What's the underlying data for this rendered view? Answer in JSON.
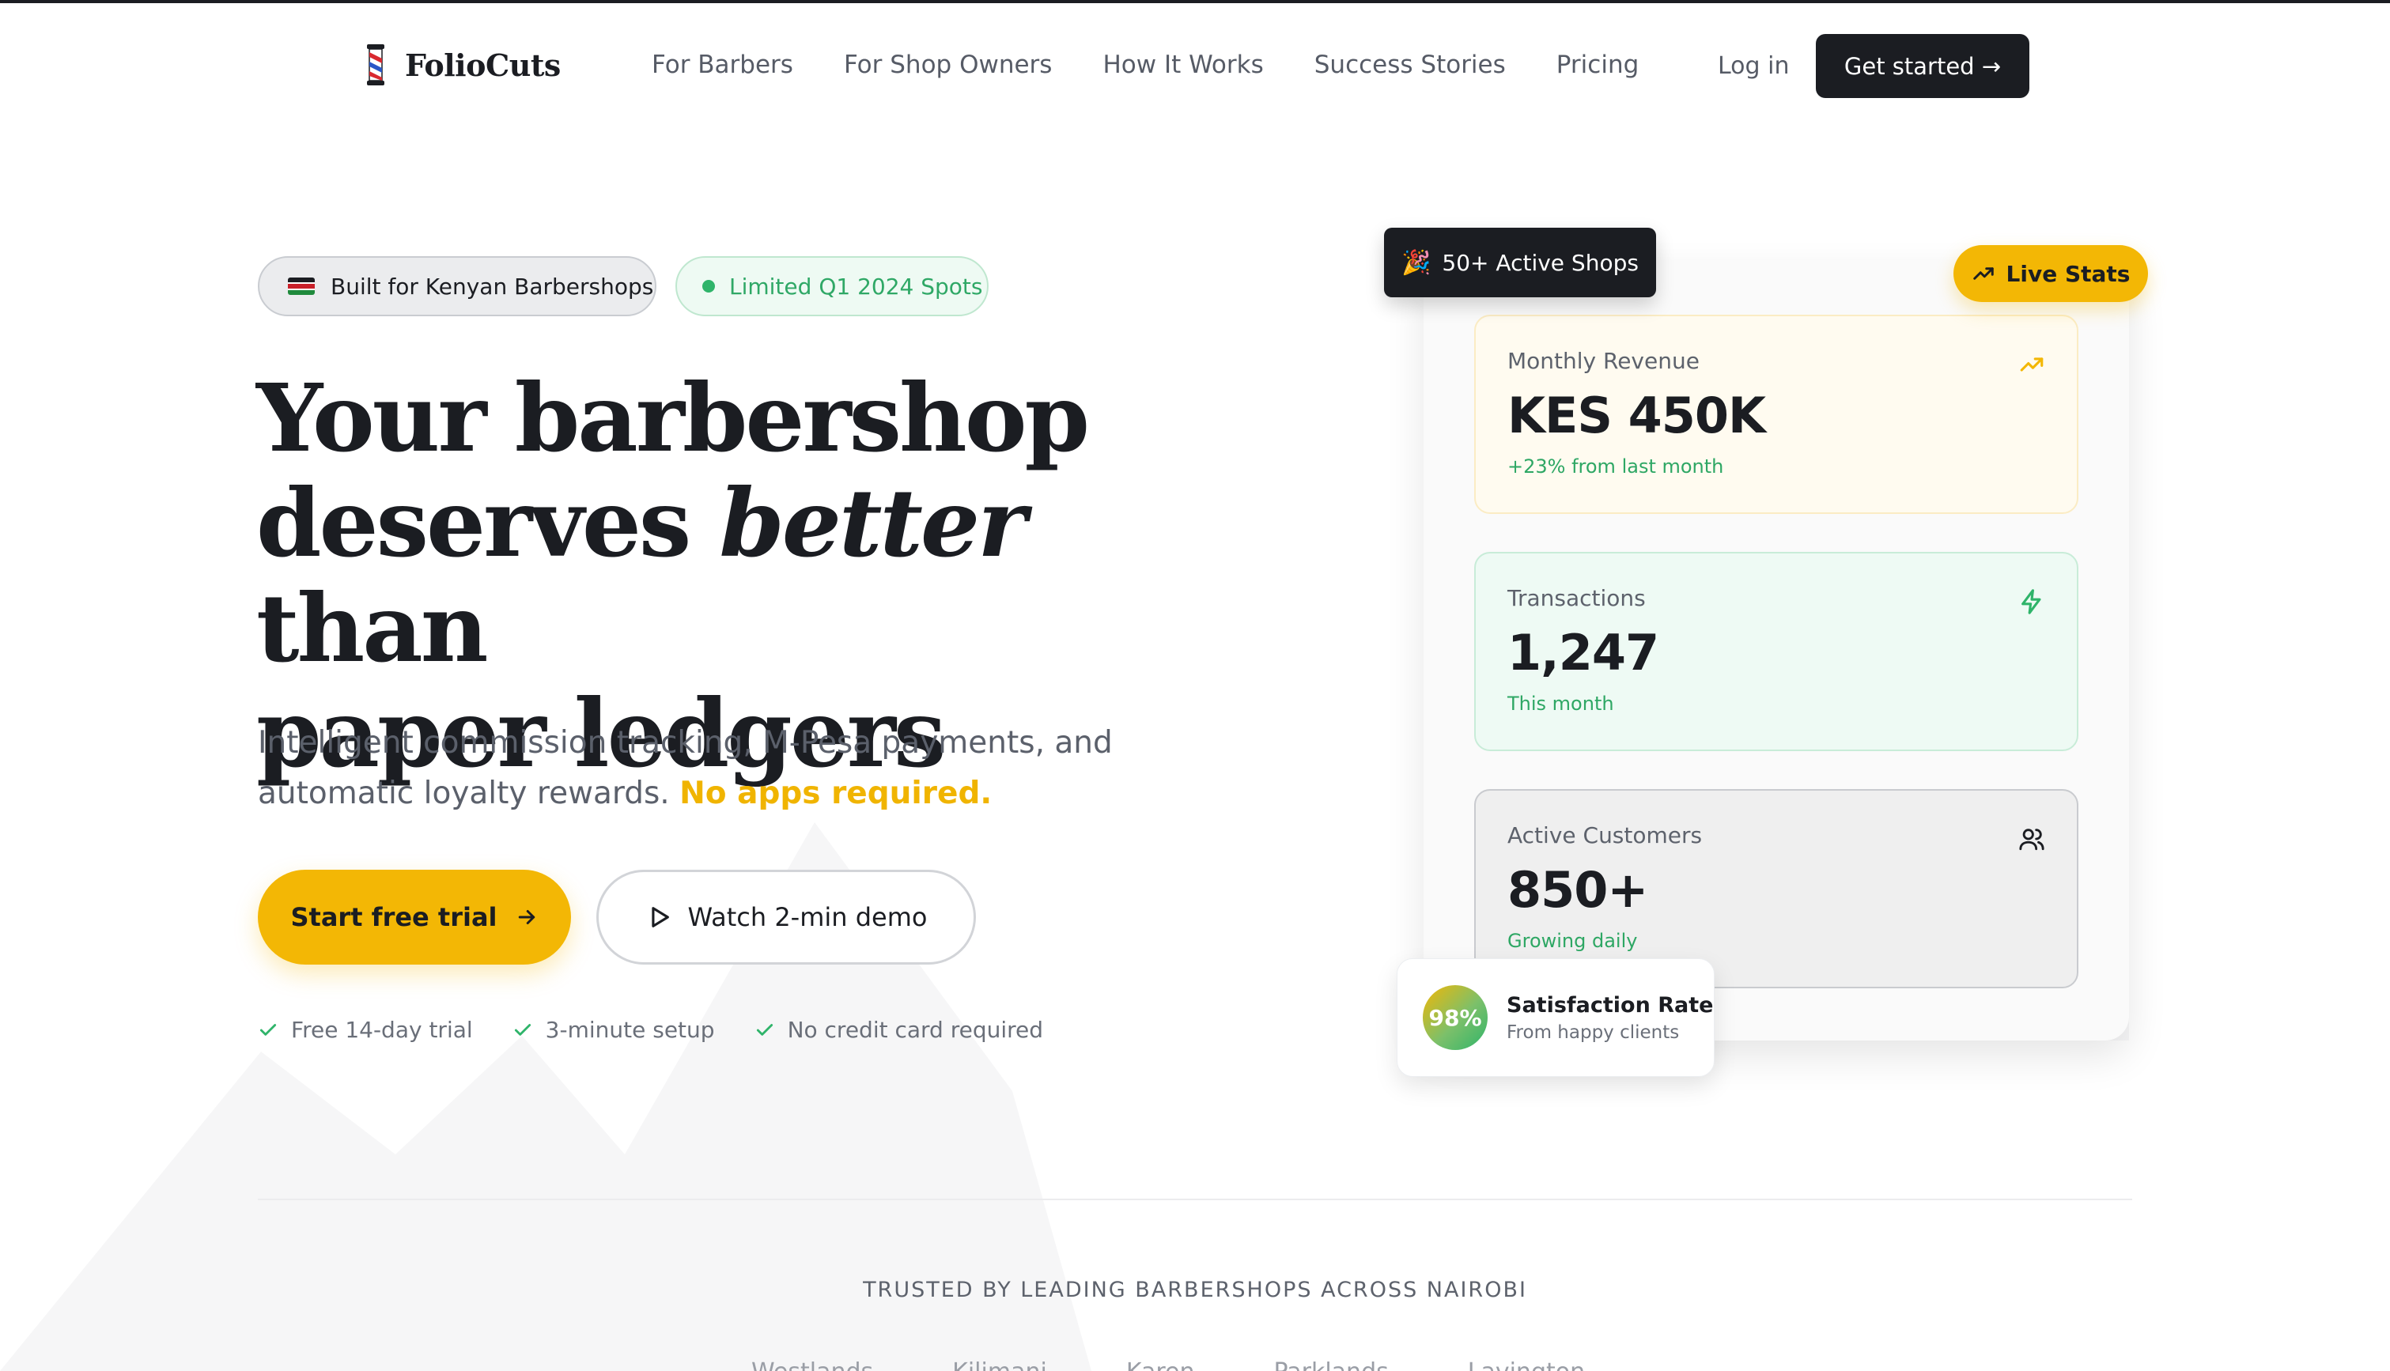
{
  "nav": {
    "brand": "FolioCuts",
    "links": [
      "For Barbers",
      "For Shop Owners",
      "How It Works",
      "Success Stories",
      "Pricing"
    ],
    "login": "Log in",
    "cta": "Get started →"
  },
  "hero": {
    "badge_kenya": "Built for Kenyan Barbershops",
    "badge_spots": "Limited Q1 2024 Spots",
    "headline_line1": "Your barbershop",
    "headline_line2_a": "deserves ",
    "headline_line2_italic": "better",
    "headline_line2_b": " than",
    "headline_line3": "paper ledgers",
    "subtext": "Intelligent commission tracking, M-Pesa payments, and automatic loyalty rewards.",
    "subtext_highlight": "No apps required.",
    "cta_primary": "Start free trial",
    "cta_secondary": "Watch 2-min demo",
    "checks": [
      "Free 14-day trial",
      "3-minute setup",
      "No credit card required"
    ]
  },
  "dashboard": {
    "badge_shops": "50+ Active Shops",
    "badge_live": "Live Stats",
    "stats": [
      {
        "label": "Monthly Revenue",
        "value": "KES 450K",
        "note": "+23% from last month",
        "icon": "trending-up-icon"
      },
      {
        "label": "Transactions",
        "value": "1,247",
        "note": "This month",
        "icon": "lightning-icon"
      },
      {
        "label": "Active Customers",
        "value": "850+",
        "note": "Growing daily",
        "icon": "users-icon"
      }
    ],
    "satisfaction": {
      "value": "98%",
      "title": "Satisfaction Rate",
      "subtitle": "From happy clients"
    }
  },
  "trusted": {
    "heading": "TRUSTED BY LEADING BARBERSHOPS ACROSS NAIROBI",
    "logos": [
      "Westlands",
      "Kilimani",
      "Karen",
      "Parklands",
      "Lavington"
    ]
  },
  "colors": {
    "accent": "#f3b705",
    "dark": "#1b1d22",
    "success": "#2fb46a"
  }
}
